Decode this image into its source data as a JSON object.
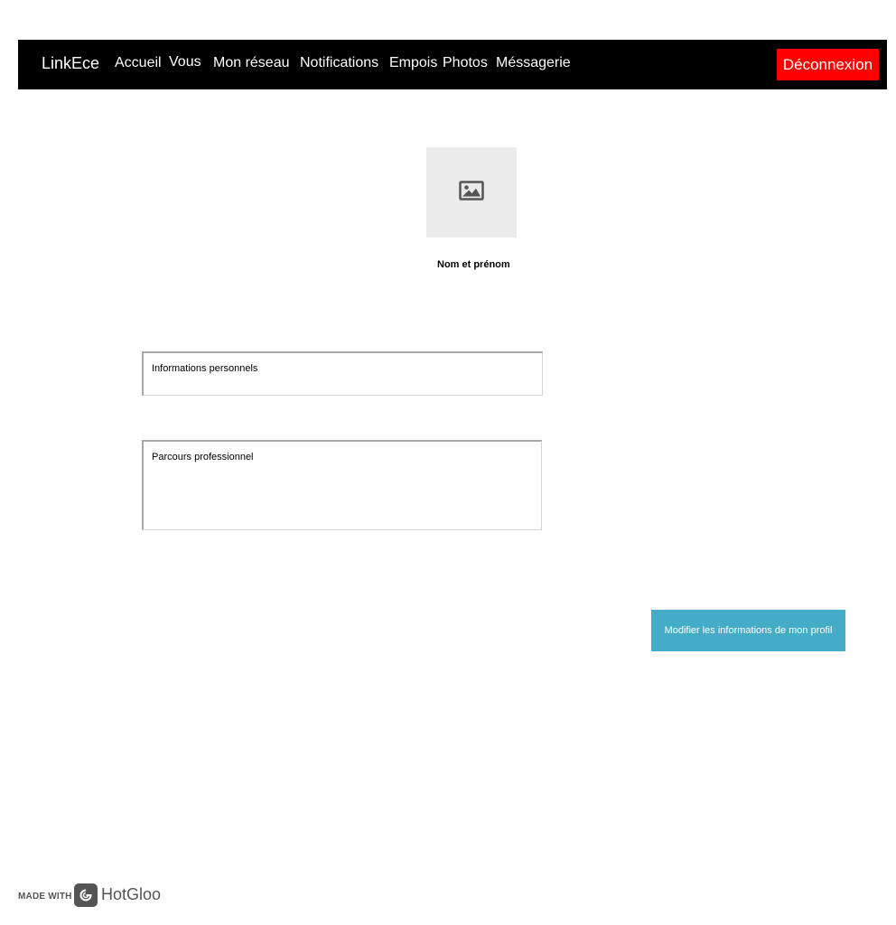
{
  "navbar": {
    "brand": "LinkEce",
    "items": [
      {
        "label": "Accueil"
      },
      {
        "label": "Vous"
      },
      {
        "label": "Mon réseau"
      },
      {
        "label": "Notifications"
      },
      {
        "label": "Empois"
      },
      {
        "label": "Photos"
      },
      {
        "label": "Méssagerie"
      }
    ],
    "logout_label": "Déconnexion",
    "background_color": "#000000",
    "logout_color": "#ff0000"
  },
  "profile": {
    "avatar_icon": "image-placeholder-icon",
    "name": "Nom et prénom"
  },
  "sections": {
    "personal_label": "Informations personnels",
    "career_label": "Parcours professionnel"
  },
  "actions": {
    "edit_profile_label": "Modifier les informations de mon profil",
    "edit_profile_color": "#45acc8"
  },
  "footer": {
    "made_with": "MADE WITH",
    "logo_icon": "hotgloo-logo-icon",
    "brand": "HotGloo"
  }
}
